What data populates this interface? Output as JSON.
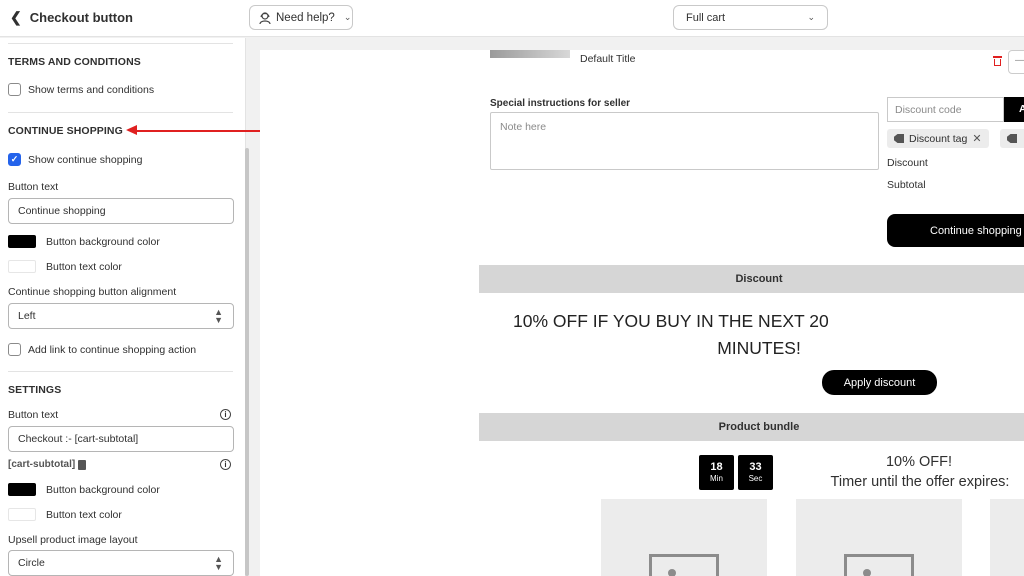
{
  "header": {
    "back_label": "Checkout button",
    "help_label": "Need help?",
    "cart_select": "Full cart"
  },
  "sidebar": {
    "terms": {
      "title": "TERMS AND CONDITIONS",
      "show_terms": "Show terms and conditions"
    },
    "continue_shopping": {
      "title": "CONTINUE SHOPPING",
      "show_label": "Show continue shopping",
      "show_checked": true,
      "button_text_label": "Button text",
      "button_text_value": "Continue shopping",
      "bg_color_label": "Button background color",
      "text_color_label": "Button text color",
      "alignment_label": "Continue shopping button alignment",
      "alignment_value": "Left",
      "add_link_label": "Add link to continue shopping action"
    },
    "settings": {
      "title": "SETTINGS",
      "button_text_label": "Button text",
      "button_text_value": "Checkout :- [cart-subtotal]",
      "cart_subtotal_tag": "[cart-subtotal]",
      "bg_color_label": "Button background color",
      "text_color_label": "Button text color",
      "upsell_layout_label": "Upsell product image layout",
      "upsell_layout_value": "Circle"
    }
  },
  "preview": {
    "default_title": "Default Title",
    "qty_stub": "—",
    "special_instructions_label": "Special instructions for seller",
    "note_placeholder": "Note here",
    "discount_code_placeholder": "Discount code",
    "apply_stub": "A",
    "discount_tag": "Discount tag",
    "discount_label": "Discount",
    "subtotal_label": "Subtotal",
    "continue_button": "Continue shopping",
    "discount_band": "Discount",
    "promo_line1": "10% OFF IF YOU BUY IN THE NEXT 20",
    "promo_line2": "MINUTES!",
    "apply_discount_button": "Apply discount",
    "bundle_band": "Product bundle",
    "timer_min_value": "18",
    "timer_min_unit": "Min",
    "timer_sec_value": "33",
    "timer_sec_unit": "Sec",
    "offer_title": "10% OFF!",
    "offer_subtitle": "Timer until the offer expires:"
  },
  "colors": {
    "accent_blue": "#2463eb",
    "annotation_red": "#e02020",
    "button_black": "#000000"
  }
}
